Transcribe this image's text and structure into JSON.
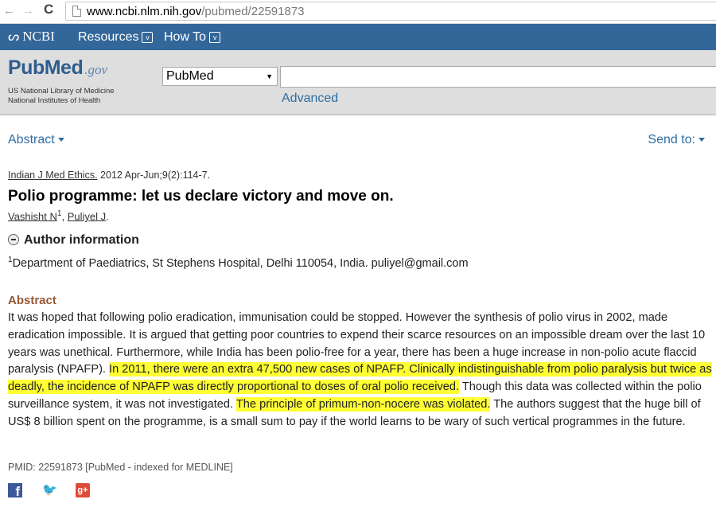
{
  "browser": {
    "url_host": "www.ncbi.nlm.nih.gov",
    "url_path": "/pubmed/22591873",
    "back_glyph": "←",
    "forward_glyph": "→",
    "reload_glyph": "C"
  },
  "ncbi_bar": {
    "logo": "NCBI",
    "logo_mark": "ᔕ",
    "resources": "Resources",
    "howto": "How To",
    "chevron": "v",
    "bg_color": "#336699"
  },
  "header": {
    "logo_main": "PubMed",
    "logo_gov": ".gov",
    "nlm_line1": "US National Library of Medicine",
    "nlm_line2": "National Institutes of Health",
    "db_selected": "PubMed",
    "db_arrow": "▼",
    "search_value": "",
    "advanced": "Advanced"
  },
  "controls": {
    "format": "Abstract",
    "send_to": "Send to:"
  },
  "article": {
    "journal": "Indian J Med Ethics.",
    "citation_rest": " 2012 Apr-Jun;9(2):114-7.",
    "title": "Polio programme: let us declare victory and move on.",
    "author1": "Vashisht N",
    "author1_sup": "1",
    "author_sep": ", ",
    "author2": "Puliyel J",
    "authors_end": ".",
    "author_info_label": "Author information",
    "affiliation_sup": "1",
    "affiliation": "Department of Paediatrics, St Stephens Hospital, Delhi 110054, India. puliyel@gmail.com",
    "abstract_heading": "Abstract",
    "abstract_p1": "It was hoped that following polio eradication, immunisation could be stopped. However the synthesis of polio virus in 2002, made eradication impossible. It is argued that getting poor countries to expend their scarce resources on an impossible dream over the last 10 years was unethical. Furthermore, while India has been polio-free for a year, there has been a huge increase in non-polio acute flaccid paralysis (NPAFP). ",
    "abstract_h1": "In 2011, there were an extra 47,500 new cases of NPAFP. Clinically indistinguishable from polio paralysis but twice as deadly, the incidence of NPAFP was directly proportional to doses of oral polio received.",
    "abstract_p2": " Though this data was collected within the polio surveillance system, it was not investigated. ",
    "abstract_h2": "The principle of primum-non-nocere was violated.",
    "abstract_p3": " The authors suggest that the huge bill of US$ 8 billion spent on the programme, is a small sum to pay if the world learns to be wary of such vertical programmes in the future.",
    "highlight_color": "#ffff33",
    "pmid_line": "PMID: 22591873 [PubMed - indexed for MEDLINE]"
  },
  "social": {
    "facebook": "f",
    "twitter": "🐦",
    "googleplus": "g+"
  }
}
